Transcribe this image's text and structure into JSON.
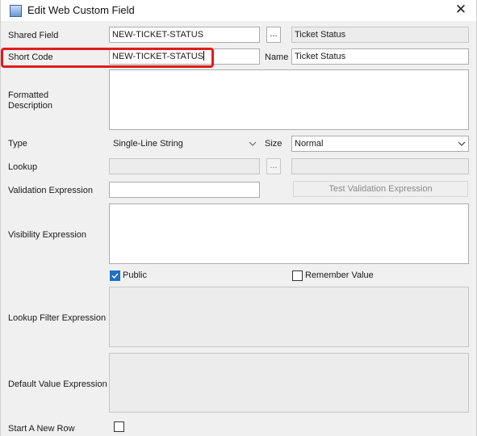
{
  "window": {
    "title": "Edit Web Custom Field",
    "close_glyph": "✕",
    "icon": "window-app-icon"
  },
  "shared_field": {
    "label": "Shared Field",
    "value": "NEW-TICKET-STATUS",
    "browse_label": "...",
    "display_value": "Ticket Status"
  },
  "short_code": {
    "label": "Short Code",
    "value": "NEW-TICKET-STATUS"
  },
  "name": {
    "label": "Name",
    "value": "Ticket Status"
  },
  "formatted_description": {
    "label_line1": "Formatted",
    "label_line2": "Description",
    "value": ""
  },
  "type": {
    "label": "Type",
    "selected": "Single-Line String"
  },
  "size": {
    "label": "Size",
    "selected": "Normal"
  },
  "lookup": {
    "label": "Lookup",
    "value": "",
    "browse_label": "...",
    "display_value": ""
  },
  "validation_expression": {
    "label": "Validation Expression",
    "value": "",
    "test_button": "Test Validation Expression"
  },
  "visibility_expression": {
    "label": "Visibility Expression",
    "value": ""
  },
  "public": {
    "label": "Public",
    "checked": true
  },
  "remember_value": {
    "label": "Remember Value",
    "checked": false
  },
  "lookup_filter_expression": {
    "label": "Lookup Filter Expression",
    "value": ""
  },
  "default_value_expression": {
    "label": "Default Value Expression",
    "value": ""
  },
  "start_new_row": {
    "label": "Start A New Row",
    "checked": false
  },
  "colors": {
    "highlight_border": "#e21b1b",
    "checkbox_checked": "#1f6fc5",
    "window_bg": "#f0f0f0"
  }
}
